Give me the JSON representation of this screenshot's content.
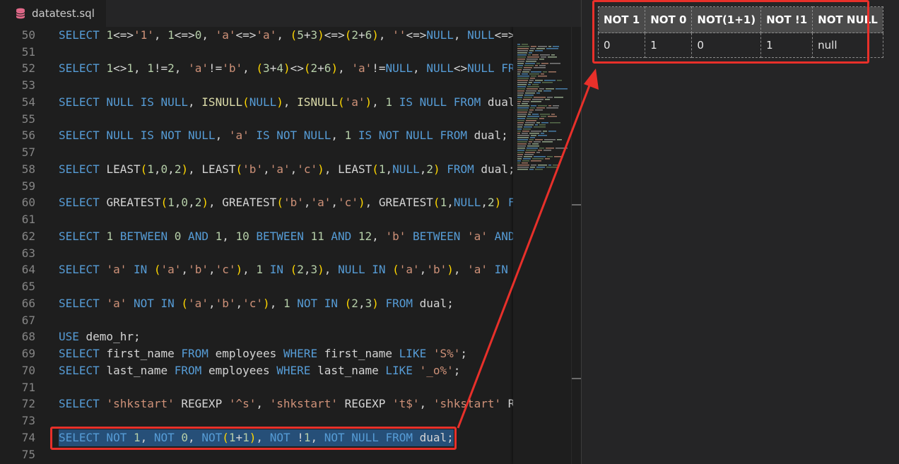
{
  "tab": {
    "filename": "datatest.sql"
  },
  "editor": {
    "lines": [
      {
        "n": "50",
        "tokens": [
          [
            "kw",
            "SELECT "
          ],
          [
            "num",
            "1"
          ],
          [
            "op",
            "<=>"
          ],
          [
            "str",
            "'1'"
          ],
          [
            "op",
            ", "
          ],
          [
            "num",
            "1"
          ],
          [
            "op",
            "<=>"
          ],
          [
            "num",
            "0"
          ],
          [
            "op",
            ", "
          ],
          [
            "str",
            "'a'"
          ],
          [
            "op",
            "<=>"
          ],
          [
            "str",
            "'a'"
          ],
          [
            "op",
            ", "
          ],
          [
            "p1",
            "("
          ],
          [
            "num",
            "5"
          ],
          [
            "op",
            "+"
          ],
          [
            "num",
            "3"
          ],
          [
            "p1",
            ")"
          ],
          [
            "op",
            "<=>"
          ],
          [
            "p1",
            "("
          ],
          [
            "num",
            "2"
          ],
          [
            "op",
            "+"
          ],
          [
            "num",
            "6"
          ],
          [
            "p1",
            ")"
          ],
          [
            "op",
            ", "
          ],
          [
            "str",
            "''"
          ],
          [
            "op",
            "<=>"
          ],
          [
            "kw",
            "NULL"
          ],
          [
            "op",
            ", "
          ],
          [
            "kw",
            "NULL"
          ],
          [
            "op",
            "<=>"
          ]
        ]
      },
      {
        "n": "51",
        "tokens": []
      },
      {
        "n": "52",
        "tokens": [
          [
            "kw",
            "SELECT "
          ],
          [
            "num",
            "1"
          ],
          [
            "op",
            "<>"
          ],
          [
            "num",
            "1"
          ],
          [
            "op",
            ", "
          ],
          [
            "num",
            "1"
          ],
          [
            "op",
            "!="
          ],
          [
            "num",
            "2"
          ],
          [
            "op",
            ", "
          ],
          [
            "str",
            "'a'"
          ],
          [
            "op",
            "!="
          ],
          [
            "str",
            "'b'"
          ],
          [
            "op",
            ", "
          ],
          [
            "p1",
            "("
          ],
          [
            "num",
            "3"
          ],
          [
            "op",
            "+"
          ],
          [
            "num",
            "4"
          ],
          [
            "p1",
            ")"
          ],
          [
            "op",
            "<>"
          ],
          [
            "p1",
            "("
          ],
          [
            "num",
            "2"
          ],
          [
            "op",
            "+"
          ],
          [
            "num",
            "6"
          ],
          [
            "p1",
            ")"
          ],
          [
            "op",
            ", "
          ],
          [
            "str",
            "'a'"
          ],
          [
            "op",
            "!="
          ],
          [
            "kw",
            "NULL"
          ],
          [
            "op",
            ", "
          ],
          [
            "kw",
            "NULL"
          ],
          [
            "op",
            "<>"
          ],
          [
            "kw",
            "NULL FR"
          ]
        ]
      },
      {
        "n": "53",
        "tokens": []
      },
      {
        "n": "54",
        "tokens": [
          [
            "kw",
            "SELECT NULL IS NULL"
          ],
          [
            "op",
            ", "
          ],
          [
            "fn",
            "ISNULL"
          ],
          [
            "p1",
            "("
          ],
          [
            "kw",
            "NULL"
          ],
          [
            "p1",
            ")"
          ],
          [
            "op",
            ", "
          ],
          [
            "fn",
            "ISNULL"
          ],
          [
            "p1",
            "("
          ],
          [
            "str",
            "'a'"
          ],
          [
            "p1",
            ")"
          ],
          [
            "op",
            ", "
          ],
          [
            "num",
            "1"
          ],
          [
            "kw",
            " IS NULL FROM "
          ],
          [
            "op",
            "dual"
          ]
        ]
      },
      {
        "n": "55",
        "tokens": []
      },
      {
        "n": "56",
        "tokens": [
          [
            "kw",
            "SELECT NULL IS NOT NULL"
          ],
          [
            "op",
            ", "
          ],
          [
            "str",
            "'a'"
          ],
          [
            "kw",
            " IS NOT NULL"
          ],
          [
            "op",
            ", "
          ],
          [
            "num",
            "1"
          ],
          [
            "kw",
            " IS NOT NULL FROM "
          ],
          [
            "op",
            "dual;"
          ]
        ]
      },
      {
        "n": "57",
        "tokens": []
      },
      {
        "n": "58",
        "tokens": [
          [
            "kw",
            "SELECT "
          ],
          [
            "op",
            "LEAST"
          ],
          [
            "p1",
            "("
          ],
          [
            "num",
            "1"
          ],
          [
            "op",
            ","
          ],
          [
            "num",
            "0"
          ],
          [
            "op",
            ","
          ],
          [
            "num",
            "2"
          ],
          [
            "p1",
            ")"
          ],
          [
            "op",
            ", LEAST"
          ],
          [
            "p1",
            "("
          ],
          [
            "str",
            "'b'"
          ],
          [
            "op",
            ","
          ],
          [
            "str",
            "'a'"
          ],
          [
            "op",
            ","
          ],
          [
            "str",
            "'c'"
          ],
          [
            "p1",
            ")"
          ],
          [
            "op",
            ", LEAST"
          ],
          [
            "p1",
            "("
          ],
          [
            "num",
            "1"
          ],
          [
            "op",
            ","
          ],
          [
            "kw",
            "NULL"
          ],
          [
            "op",
            ","
          ],
          [
            "num",
            "2"
          ],
          [
            "p1",
            ")"
          ],
          [
            "kw",
            " FROM "
          ],
          [
            "op",
            "dual;"
          ]
        ]
      },
      {
        "n": "59",
        "tokens": []
      },
      {
        "n": "60",
        "tokens": [
          [
            "kw",
            "SELECT "
          ],
          [
            "op",
            "GREATEST"
          ],
          [
            "p1",
            "("
          ],
          [
            "num",
            "1"
          ],
          [
            "op",
            ","
          ],
          [
            "num",
            "0"
          ],
          [
            "op",
            ","
          ],
          [
            "num",
            "2"
          ],
          [
            "p1",
            ")"
          ],
          [
            "op",
            ", GREATEST"
          ],
          [
            "p1",
            "("
          ],
          [
            "str",
            "'b'"
          ],
          [
            "op",
            ","
          ],
          [
            "str",
            "'a'"
          ],
          [
            "op",
            ","
          ],
          [
            "str",
            "'c'"
          ],
          [
            "p1",
            ")"
          ],
          [
            "op",
            ", GREATEST"
          ],
          [
            "p1",
            "("
          ],
          [
            "num",
            "1"
          ],
          [
            "op",
            ","
          ],
          [
            "kw",
            "NULL"
          ],
          [
            "op",
            ","
          ],
          [
            "num",
            "2"
          ],
          [
            "p1",
            ")"
          ],
          [
            "kw",
            " F"
          ]
        ]
      },
      {
        "n": "61",
        "tokens": []
      },
      {
        "n": "62",
        "tokens": [
          [
            "kw",
            "SELECT "
          ],
          [
            "num",
            "1"
          ],
          [
            "kw",
            " BETWEEN "
          ],
          [
            "num",
            "0"
          ],
          [
            "kw",
            " AND "
          ],
          [
            "num",
            "1"
          ],
          [
            "op",
            ", "
          ],
          [
            "num",
            "10"
          ],
          [
            "kw",
            " BETWEEN "
          ],
          [
            "num",
            "11"
          ],
          [
            "kw",
            " AND "
          ],
          [
            "num",
            "12"
          ],
          [
            "op",
            ", "
          ],
          [
            "str",
            "'b'"
          ],
          [
            "kw",
            " BETWEEN "
          ],
          [
            "str",
            "'a'"
          ],
          [
            "kw",
            " AND"
          ]
        ]
      },
      {
        "n": "63",
        "tokens": []
      },
      {
        "n": "64",
        "tokens": [
          [
            "kw",
            "SELECT "
          ],
          [
            "str",
            "'a'"
          ],
          [
            "kw",
            " IN "
          ],
          [
            "p1",
            "("
          ],
          [
            "str",
            "'a'"
          ],
          [
            "op",
            ","
          ],
          [
            "str",
            "'b'"
          ],
          [
            "op",
            ","
          ],
          [
            "str",
            "'c'"
          ],
          [
            "p1",
            ")"
          ],
          [
            "op",
            ", "
          ],
          [
            "num",
            "1"
          ],
          [
            "kw",
            " IN "
          ],
          [
            "p1",
            "("
          ],
          [
            "num",
            "2"
          ],
          [
            "op",
            ","
          ],
          [
            "num",
            "3"
          ],
          [
            "p1",
            ")"
          ],
          [
            "op",
            ", "
          ],
          [
            "kw",
            "NULL IN "
          ],
          [
            "p1",
            "("
          ],
          [
            "str",
            "'a'"
          ],
          [
            "op",
            ","
          ],
          [
            "str",
            "'b'"
          ],
          [
            "p1",
            ")"
          ],
          [
            "op",
            ", "
          ],
          [
            "str",
            "'a'"
          ],
          [
            "kw",
            " IN"
          ]
        ]
      },
      {
        "n": "65",
        "tokens": []
      },
      {
        "n": "66",
        "tokens": [
          [
            "kw",
            "SELECT "
          ],
          [
            "str",
            "'a'"
          ],
          [
            "kw",
            " NOT IN "
          ],
          [
            "p1",
            "("
          ],
          [
            "str",
            "'a'"
          ],
          [
            "op",
            ","
          ],
          [
            "str",
            "'b'"
          ],
          [
            "op",
            ","
          ],
          [
            "str",
            "'c'"
          ],
          [
            "p1",
            ")"
          ],
          [
            "op",
            ", "
          ],
          [
            "num",
            "1"
          ],
          [
            "kw",
            " NOT IN "
          ],
          [
            "p1",
            "("
          ],
          [
            "num",
            "2"
          ],
          [
            "op",
            ","
          ],
          [
            "num",
            "3"
          ],
          [
            "p1",
            ")"
          ],
          [
            "kw",
            " FROM "
          ],
          [
            "op",
            "dual;"
          ]
        ]
      },
      {
        "n": "67",
        "tokens": []
      },
      {
        "n": "68",
        "tokens": [
          [
            "kw",
            "USE "
          ],
          [
            "op",
            "demo_hr;"
          ]
        ]
      },
      {
        "n": "69",
        "tokens": [
          [
            "kw",
            "SELECT "
          ],
          [
            "op",
            "first_name "
          ],
          [
            "kw",
            "FROM "
          ],
          [
            "op",
            "employees "
          ],
          [
            "kw",
            "WHERE "
          ],
          [
            "op",
            "first_name "
          ],
          [
            "kw",
            "LIKE "
          ],
          [
            "str",
            "'S%'"
          ],
          [
            "op",
            ";"
          ]
        ]
      },
      {
        "n": "70",
        "tokens": [
          [
            "kw",
            "SELECT "
          ],
          [
            "op",
            "last_name "
          ],
          [
            "kw",
            "FROM "
          ],
          [
            "op",
            "employees "
          ],
          [
            "kw",
            "WHERE "
          ],
          [
            "op",
            "last_name "
          ],
          [
            "kw",
            "LIKE "
          ],
          [
            "str",
            "'_o%'"
          ],
          [
            "op",
            ";"
          ]
        ]
      },
      {
        "n": "71",
        "tokens": []
      },
      {
        "n": "72",
        "tokens": [
          [
            "kw",
            "SELECT "
          ],
          [
            "str",
            "'shkstart'"
          ],
          [
            "op",
            " REGEXP "
          ],
          [
            "str",
            "'^s'"
          ],
          [
            "op",
            ", "
          ],
          [
            "str",
            "'shkstart'"
          ],
          [
            "op",
            " REGEXP "
          ],
          [
            "str",
            "'t$'"
          ],
          [
            "op",
            ", "
          ],
          [
            "str",
            "'shkstart'"
          ],
          [
            "op",
            " R"
          ]
        ]
      },
      {
        "n": "73",
        "tokens": []
      },
      {
        "n": "74",
        "selected": true,
        "tokens": [
          [
            "kw",
            "SELECT NOT "
          ],
          [
            "num",
            "1"
          ],
          [
            "op",
            ", "
          ],
          [
            "kw",
            "NOT "
          ],
          [
            "num",
            "0"
          ],
          [
            "op",
            ", "
          ],
          [
            "kw",
            "NOT"
          ],
          [
            "p1",
            "("
          ],
          [
            "num",
            "1"
          ],
          [
            "op",
            "+"
          ],
          [
            "num",
            "1"
          ],
          [
            "p1",
            ")"
          ],
          [
            "op",
            ", "
          ],
          [
            "kw",
            "NOT "
          ],
          [
            "op",
            "!"
          ],
          [
            "num",
            "1"
          ],
          [
            "op",
            ", "
          ],
          [
            "kw",
            "NOT NULL FROM "
          ],
          [
            "op",
            "dual;"
          ]
        ]
      },
      {
        "n": "75",
        "tokens": []
      }
    ]
  },
  "result": {
    "columns": [
      "NOT 1",
      "NOT 0",
      "NOT(1+1)",
      "NOT !1",
      "NOT NULL"
    ],
    "rows": [
      [
        "0",
        "1",
        "0",
        "1",
        "null"
      ]
    ]
  },
  "colors": {
    "keyword": "#569cd6",
    "string": "#ce9178",
    "number": "#b5cea8",
    "bracket": "#ffd700",
    "annotation": "#e8302a",
    "selection": "#264f78"
  },
  "icons": {
    "tab": "database-icon"
  }
}
